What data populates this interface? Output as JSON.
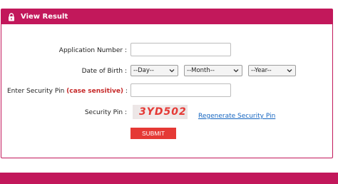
{
  "header": {
    "title": "View Result",
    "icon": "lock-icon",
    "color": "#c2185b"
  },
  "form": {
    "application_number_label": "Application Number :",
    "application_number_value": "",
    "dob_label": "Date of Birth :",
    "dob_day": "--Day--",
    "dob_month": "--Month--",
    "dob_year": "--Year--",
    "security_pin_entry_label_prefix": "Enter Security Pin ",
    "security_pin_entry_label_highlight": "(case sensitive)",
    "security_pin_entry_label_suffix": " :",
    "security_pin_entry_value": "",
    "security_pin_label": "Security Pin :",
    "captcha_text": "3YD502",
    "regenerate_label": "Regenerate Security Pin",
    "submit_label": "SUBMIT"
  },
  "colors": {
    "accent": "#c2185b",
    "submit": "#e53935",
    "link": "#1565c0",
    "highlight_red": "#c62828"
  }
}
